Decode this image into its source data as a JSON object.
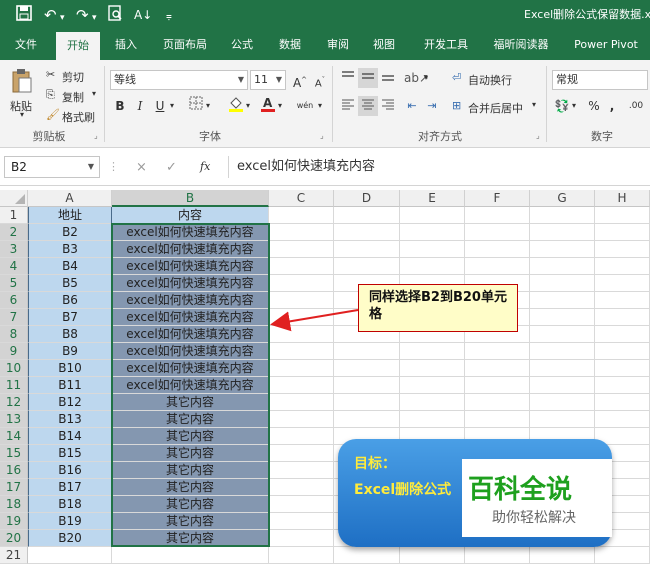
{
  "titlebar": {
    "save_icon": "save-icon",
    "undo_icon": "undo-icon",
    "redo_icon": "redo-icon",
    "preview_icon": "print-preview-icon",
    "sort_icon": "sort-icon",
    "customize_icon": "customize-qat-icon",
    "title": "Excel删除公式保留数据.x"
  },
  "tabs": [
    "文件",
    "开始",
    "插入",
    "页面布局",
    "公式",
    "数据",
    "审阅",
    "视图",
    "开发工具",
    "福昕阅读器",
    "Power Pivot"
  ],
  "ribbon": {
    "clipboard": {
      "paste": "粘贴",
      "cut": "剪切",
      "copy": "复制",
      "format_painter": "格式刷",
      "label": "剪贴板"
    },
    "font": {
      "name": "等线",
      "size": "11",
      "bold": "B",
      "italic": "I",
      "underline": "U",
      "grow": "A",
      "shrink": "A",
      "phonetic": "wén",
      "label": "字体"
    },
    "alignment": {
      "wrap": "自动换行",
      "merge": "合并后居中",
      "label": "对齐方式"
    },
    "number": {
      "format": "常规",
      "percent": "%",
      "comma": ",",
      "increase_decimal": ".00",
      "label": "数字"
    }
  },
  "formula_bar": {
    "name_box": "B2",
    "cancel": "×",
    "enter": "✓",
    "fx": "fx",
    "content": "excel如何快速填充内容"
  },
  "columns": [
    "A",
    "B",
    "C",
    "D",
    "E",
    "F",
    "G",
    "H"
  ],
  "rows": [
    "1",
    "2",
    "3",
    "4",
    "5",
    "6",
    "7",
    "8",
    "9",
    "10",
    "11",
    "12",
    "13",
    "14",
    "15",
    "16",
    "17",
    "18",
    "19",
    "20",
    "21"
  ],
  "header": {
    "a": "地址",
    "b": "内容"
  },
  "table": [
    {
      "a": "B2",
      "b": "excel如何快速填充内容"
    },
    {
      "a": "B3",
      "b": "excel如何快速填充内容"
    },
    {
      "a": "B4",
      "b": "excel如何快速填充内容"
    },
    {
      "a": "B5",
      "b": "excel如何快速填充内容"
    },
    {
      "a": "B6",
      "b": "excel如何快速填充内容"
    },
    {
      "a": "B7",
      "b": "excel如何快速填充内容"
    },
    {
      "a": "B8",
      "b": "excel如何快速填充内容"
    },
    {
      "a": "B9",
      "b": "excel如何快速填充内容"
    },
    {
      "a": "B10",
      "b": "excel如何快速填充内容"
    },
    {
      "a": "B11",
      "b": "excel如何快速填充内容"
    },
    {
      "a": "B12",
      "b": "其它内容"
    },
    {
      "a": "B13",
      "b": "其它内容"
    },
    {
      "a": "B14",
      "b": "其它内容"
    },
    {
      "a": "B15",
      "b": "其它内容"
    },
    {
      "a": "B16",
      "b": "其它内容"
    },
    {
      "a": "B17",
      "b": "其它内容"
    },
    {
      "a": "B18",
      "b": "其它内容"
    },
    {
      "a": "B19",
      "b": "其它内容"
    },
    {
      "a": "B20",
      "b": "其它内容"
    }
  ],
  "callout": "同样选择B2到B20单元格",
  "goal": {
    "line1": "目标：",
    "line2": "Excel删除公式"
  },
  "watermark": {
    "big": "百科全说",
    "small": "助你轻松解决"
  },
  "colors": {
    "excel_green": "#217346",
    "address_fill": "#bdd7ee",
    "selected_fill": "#8497b0",
    "arrow": "#e02020"
  }
}
